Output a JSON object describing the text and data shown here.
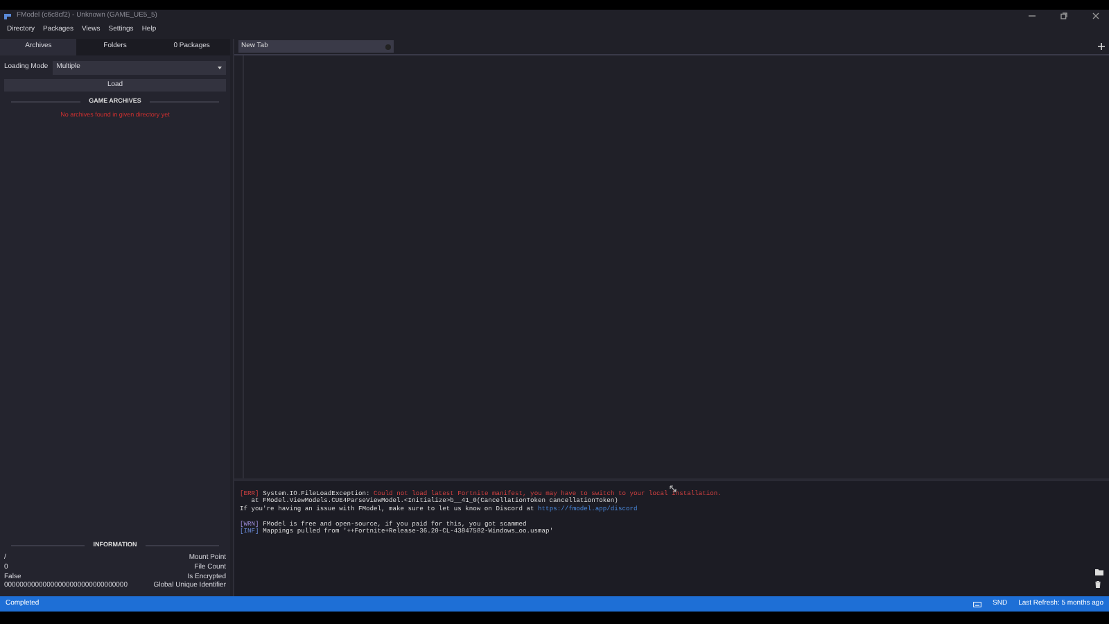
{
  "window": {
    "title": "FModel (c6c8cf2) - Unknown (GAME_UE5_5)"
  },
  "menu": [
    "Directory",
    "Packages",
    "Views",
    "Settings",
    "Help"
  ],
  "left_tabs": [
    {
      "label": "Archives",
      "selected": true
    },
    {
      "label": "Folders",
      "selected": false
    },
    {
      "label": "0 Packages",
      "selected": false
    }
  ],
  "loading_mode": {
    "label": "Loading Mode",
    "value": "Multiple"
  },
  "load_button": "Load",
  "game_archives": {
    "heading": "GAME ARCHIVES",
    "message": "No archives found in given directory yet"
  },
  "information": {
    "heading": "INFORMATION",
    "rows": [
      {
        "value": "/",
        "label": "Mount Point"
      },
      {
        "value": "0",
        "label": "File Count"
      },
      {
        "value": "False",
        "label": "Is Encrypted"
      },
      {
        "value": "00000000000000000000000000000000",
        "label": "Global Unique Identifier"
      }
    ]
  },
  "document_tabs": [
    {
      "label": "New Tab",
      "selected": true
    }
  ],
  "log": [
    {
      "segments": [
        {
          "kind": "tag-err",
          "text": "[ERR]"
        },
        {
          "kind": "plain",
          "text": "System.IO.FileLoadException:"
        },
        {
          "kind": "error",
          "text": "Could not load latest Fortnite manifest, you may have to switch to your local installation."
        }
      ]
    },
    {
      "segments": [
        {
          "kind": "plain",
          "text": "   at FModel.ViewModels.CUE4ParseViewModel.<Initialize>b__41_0(CancellationToken cancellationToken)"
        }
      ]
    },
    {
      "segments": [
        {
          "kind": "plain",
          "text": "If you're having an issue with FModel, make sure to let us know on Discord at"
        },
        {
          "kind": "link",
          "text": "https://fmodel.app/discord"
        }
      ]
    },
    {
      "gap_before": true,
      "segments": [
        {
          "kind": "tag-wrn",
          "text": "[WRN]"
        },
        {
          "kind": "plain",
          "text": "FModel is free and open-source, if you paid for this, you got scammed"
        }
      ]
    },
    {
      "segments": [
        {
          "kind": "tag-inf",
          "text": "[INF]"
        },
        {
          "kind": "plain",
          "text": "Mappings pulled from '++Fortnite+Release-36.20-CL-43847582-Windows_oo.usmap'"
        }
      ]
    }
  ],
  "status_bar": {
    "status": "Completed",
    "keyboard_layout": "SND",
    "last_refresh": "Last Refresh: 5 months ago"
  }
}
